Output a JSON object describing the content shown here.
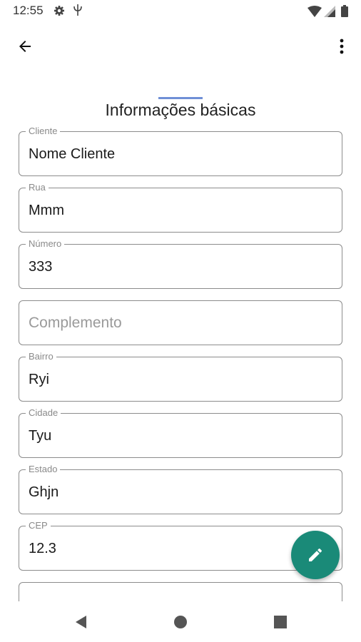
{
  "status_bar": {
    "time": "12:55",
    "icons": [
      "settings-gear-icon",
      "phi-icon",
      "wifi-icon",
      "signal-icon",
      "battery-icon"
    ]
  },
  "app_bar": {
    "back_icon": "arrow-back-icon",
    "menu_icon": "more-vert-icon"
  },
  "section": {
    "title": "Informações básicas",
    "accent_color": "#6f8fd6"
  },
  "form": {
    "fields": [
      {
        "label": "Cliente",
        "value": "Nome Cliente"
      },
      {
        "label": "Rua",
        "value": "Mmm"
      },
      {
        "label": "Número",
        "value": "333"
      },
      {
        "label": "",
        "placeholder": "Complemento",
        "value": ""
      },
      {
        "label": "Bairro",
        "value": "Ryi"
      },
      {
        "label": "Cidade",
        "value": "Tyu"
      },
      {
        "label": "Estado",
        "value": "Ghjn"
      },
      {
        "label": "CEP",
        "value": "12.3"
      }
    ]
  },
  "fab": {
    "icon": "pencil-edit-icon",
    "color": "#1a8a78"
  },
  "nav_bar": {
    "icons": [
      "nav-back-triangle-icon",
      "nav-home-circle-icon",
      "nav-recents-square-icon"
    ]
  }
}
